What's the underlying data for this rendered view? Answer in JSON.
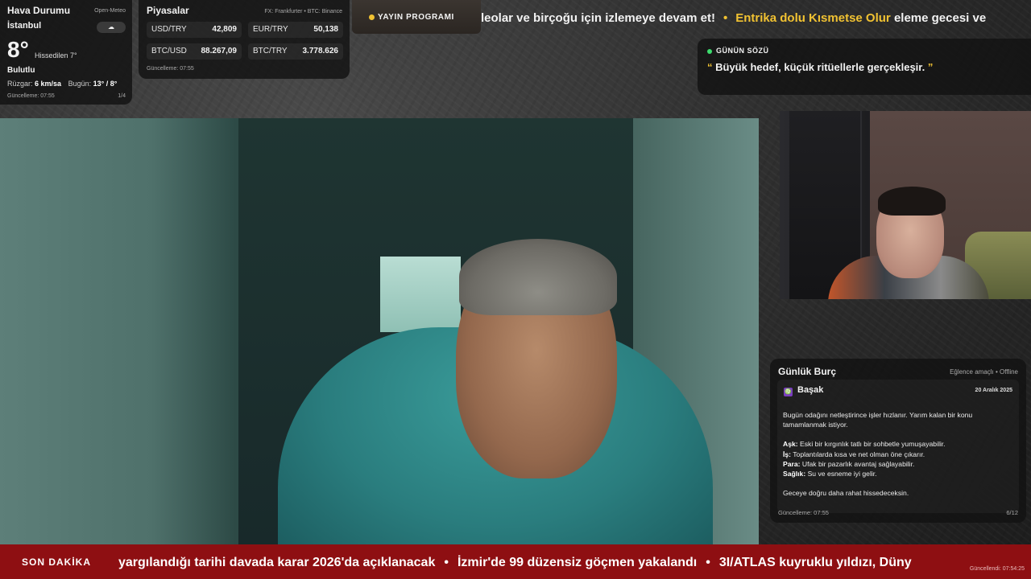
{
  "weather": {
    "title": "Hava Durumu",
    "source": "Open-Meteo",
    "city": "İstanbul",
    "icon": "cloud-icon",
    "temperature": "8°",
    "feels_like": "Hissedilen 7°",
    "condition": "Bulutlu",
    "wind_label": "Rüzgar:",
    "wind_value": "6 km/sa",
    "today_label": "Bugün:",
    "today_value": "13° / 8°",
    "updated": "Güncelleme: 07:55",
    "page": "1/4"
  },
  "markets": {
    "title": "Piyasalar",
    "source": "FX: Frankfurter • BTC: Binance",
    "items": [
      {
        "pair": "USD/TRY",
        "value": "42,809"
      },
      {
        "pair": "EUR/TRY",
        "value": "50,138"
      },
      {
        "pair": "BTC/USD",
        "value": "88.267,09"
      },
      {
        "pair": "BTC/TRY",
        "value": "3.778.626"
      }
    ],
    "updated": "Güncelleme: 07:55"
  },
  "schedule": {
    "label": "YAYIN PROGRAMI"
  },
  "top_ticker": {
    "part1": "leolar ve birçoğu için izlemeye devam et!",
    "separator": "•",
    "part2_highlight": "Entrika dolu Kısmetse Olur",
    "part2_rest": "eleme gecesi ve"
  },
  "quote": {
    "title": "GÜNÜN SÖZÜ",
    "open_mark": "“",
    "text": "Büyük hedef, küçük ritüellerle gerçekleşir.",
    "close_mark": "”"
  },
  "horoscope": {
    "title": "Günlük Burç",
    "note": "Eğlence amaçlı • Offline",
    "sign_icon": "virgo-icon",
    "sign_symbol": "♍",
    "sign": "Başak",
    "date": "20 Aralık 2025",
    "intro": "Bugün odağını netleştirince işler hızlanır. Yarım kalan bir konu tamamlanmak istiyor.",
    "love_label": "Aşk:",
    "love": "Eski bir kırgınlık tatlı bir sohbetle yumuşayabilir.",
    "work_label": "İş:",
    "work": "Toplantılarda kısa ve net olman öne çıkarır.",
    "money_label": "Para:",
    "money": "Ufak bir pazarlık avantaj sağlayabilir.",
    "health_label": "Sağlık:",
    "health": "Su ve esneme iyi gelir.",
    "closing": "Geceye doğru daha rahat hissedeceksin.",
    "updated": "Güncelleme: 07:55",
    "page": "6/12"
  },
  "news": {
    "label": "SON DAKİKA",
    "items": [
      "yargılandığı tarihi davada karar 2026'da açıklanacak",
      "İzmir'de 99 düzensiz göçmen yakalandı",
      "3I/ATLAS kuyruklu yıldızı, Düny"
    ],
    "separator": "•",
    "updated": "Güncellendi: 07:54:25"
  },
  "colors": {
    "accent_yellow": "#f1c232",
    "news_red": "#8e0f12",
    "live_green": "#3ddc6e"
  }
}
